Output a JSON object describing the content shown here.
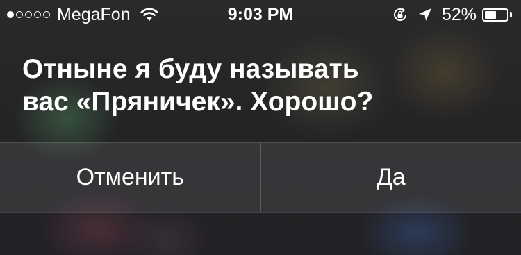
{
  "status_bar": {
    "signal_bars_filled": 1,
    "signal_bars_total": 5,
    "carrier": "MegaFon",
    "time": "9:03 PM",
    "battery_percent_label": "52%",
    "battery_level": 0.52,
    "icons": [
      "wifi-icon",
      "rotation-lock-icon",
      "location-arrow-icon",
      "battery-icon"
    ]
  },
  "siri": {
    "line1": "Отныне я буду называть",
    "line2": "вас «Пряничек». Хорошо?"
  },
  "buttons": {
    "cancel_label": "Отменить",
    "confirm_label": "Да"
  }
}
